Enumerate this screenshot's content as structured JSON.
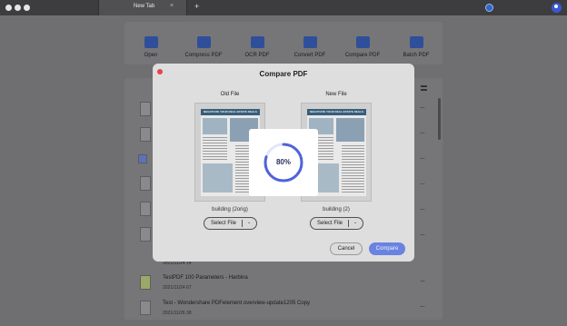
{
  "window": {
    "tab_title": "New Tab",
    "tab_close": "×",
    "new_tab": "+"
  },
  "toolbar": {
    "items": [
      {
        "label": "Open",
        "icon": "folder-icon"
      },
      {
        "label": "Compress PDF",
        "icon": "compress-icon"
      },
      {
        "label": "OCR PDF",
        "icon": "ocr-icon"
      },
      {
        "label": "Convert PDF",
        "icon": "convert-icon"
      },
      {
        "label": "Compare PDF",
        "icon": "compare-icon"
      },
      {
        "label": "Batch PDF",
        "icon": "batch-icon"
      }
    ]
  },
  "file_list": {
    "rows": [
      {
        "title": "TestPDF 100 Parameters - Harbina",
        "meta": "2021/11/24    67",
        "menu": "···"
      },
      {
        "title": "Test - Wondershare PDFelement overview-update1205 Copy",
        "meta": "2021/11/26    38",
        "menu": "···"
      }
    ],
    "partial_meta": "2021/11/24    14"
  },
  "dialog": {
    "title": "Compare PDF",
    "old_label": "Old File",
    "new_label": "New File",
    "old_file_name": "building (2orig)",
    "new_file_name": "building (2)",
    "select_file_label": "Select File",
    "select_caret": "⌄",
    "cancel_label": "Cancel",
    "compare_label": "Compare",
    "doc_heading": "NEGOTIATE YOUR REAL ESTATE DEALS"
  },
  "progress": {
    "percent_label": "80%",
    "value": 0.8
  },
  "colors": {
    "accent": "#4e64d8",
    "close_red": "#e1454c",
    "compare_button": "#6a83e0"
  }
}
